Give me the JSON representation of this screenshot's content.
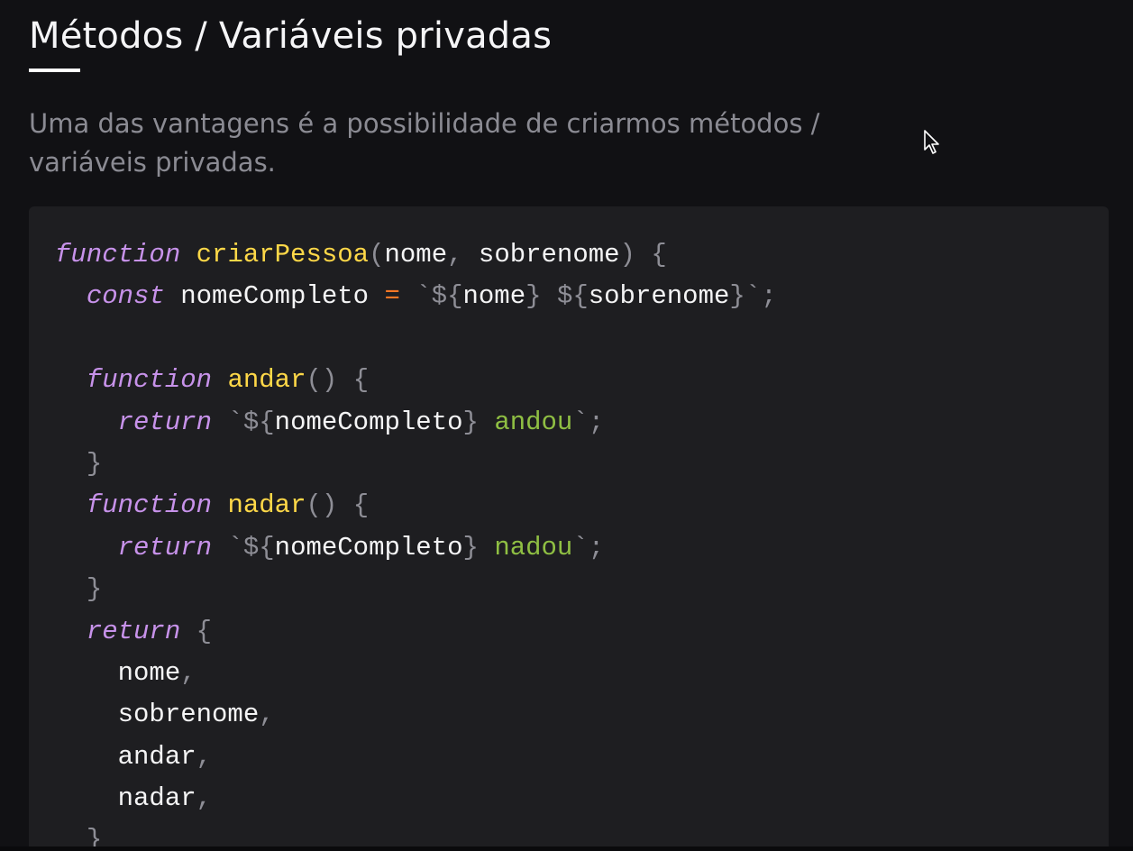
{
  "header": {
    "title": "Métodos / Variáveis privadas"
  },
  "lead": {
    "text": "Uma das vantagens é a possibilidade de criarmos métodos / variáveis privadas."
  },
  "cursor": {
    "icon": "mouse-pointer-icon"
  },
  "colors": {
    "background": "#111114",
    "code_background": "#1e1e21",
    "keyword": "#c792ea",
    "function_name": "#ffd848",
    "operator": "#f77725",
    "string": "#8fbf43",
    "punctuation": "#8e8e96",
    "identifier": "#f4f4f5"
  },
  "code": {
    "language": "javascript",
    "lines": [
      [
        [
          "kw",
          "function"
        ],
        [
          "id",
          " "
        ],
        [
          "fn",
          "criarPessoa"
        ],
        [
          "pu",
          "("
        ],
        [
          "id",
          "nome"
        ],
        [
          "pu",
          ","
        ],
        [
          "id",
          " sobrenome"
        ],
        [
          "pu",
          ")"
        ],
        [
          "id",
          " "
        ],
        [
          "pu",
          "{"
        ]
      ],
      [
        [
          "id",
          "  "
        ],
        [
          "kw",
          "const"
        ],
        [
          "id",
          " nomeCompleto "
        ],
        [
          "op",
          "="
        ],
        [
          "id",
          " "
        ],
        [
          "pu",
          "`${"
        ],
        [
          "id",
          "nome"
        ],
        [
          "pu",
          "}"
        ],
        [
          "id",
          " "
        ],
        [
          "pu",
          "${"
        ],
        [
          "id",
          "sobrenome"
        ],
        [
          "pu",
          "}`;"
        ]
      ],
      [],
      [
        [
          "id",
          "  "
        ],
        [
          "kw",
          "function"
        ],
        [
          "id",
          " "
        ],
        [
          "fn",
          "andar"
        ],
        [
          "pu",
          "()"
        ],
        [
          "id",
          " "
        ],
        [
          "pu",
          "{"
        ]
      ],
      [
        [
          "id",
          "    "
        ],
        [
          "kw",
          "return"
        ],
        [
          "id",
          " "
        ],
        [
          "pu",
          "`${"
        ],
        [
          "id",
          "nomeCompleto"
        ],
        [
          "pu",
          "}"
        ],
        [
          "str",
          " andou"
        ],
        [
          "pu",
          "`;"
        ]
      ],
      [
        [
          "id",
          "  "
        ],
        [
          "pu",
          "}"
        ]
      ],
      [
        [
          "id",
          "  "
        ],
        [
          "kw",
          "function"
        ],
        [
          "id",
          " "
        ],
        [
          "fn",
          "nadar"
        ],
        [
          "pu",
          "()"
        ],
        [
          "id",
          " "
        ],
        [
          "pu",
          "{"
        ]
      ],
      [
        [
          "id",
          "    "
        ],
        [
          "kw",
          "return"
        ],
        [
          "id",
          " "
        ],
        [
          "pu",
          "`${"
        ],
        [
          "id",
          "nomeCompleto"
        ],
        [
          "pu",
          "}"
        ],
        [
          "str",
          " nadou"
        ],
        [
          "pu",
          "`;"
        ]
      ],
      [
        [
          "id",
          "  "
        ],
        [
          "pu",
          "}"
        ]
      ],
      [
        [
          "id",
          "  "
        ],
        [
          "kw",
          "return"
        ],
        [
          "id",
          " "
        ],
        [
          "pu",
          "{"
        ]
      ],
      [
        [
          "id",
          "    nome"
        ],
        [
          "pu",
          ","
        ]
      ],
      [
        [
          "id",
          "    sobrenome"
        ],
        [
          "pu",
          ","
        ]
      ],
      [
        [
          "id",
          "    andar"
        ],
        [
          "pu",
          ","
        ]
      ],
      [
        [
          "id",
          "    nadar"
        ],
        [
          "pu",
          ","
        ]
      ],
      [
        [
          "id",
          "  "
        ],
        [
          "pu",
          "}"
        ]
      ]
    ]
  }
}
